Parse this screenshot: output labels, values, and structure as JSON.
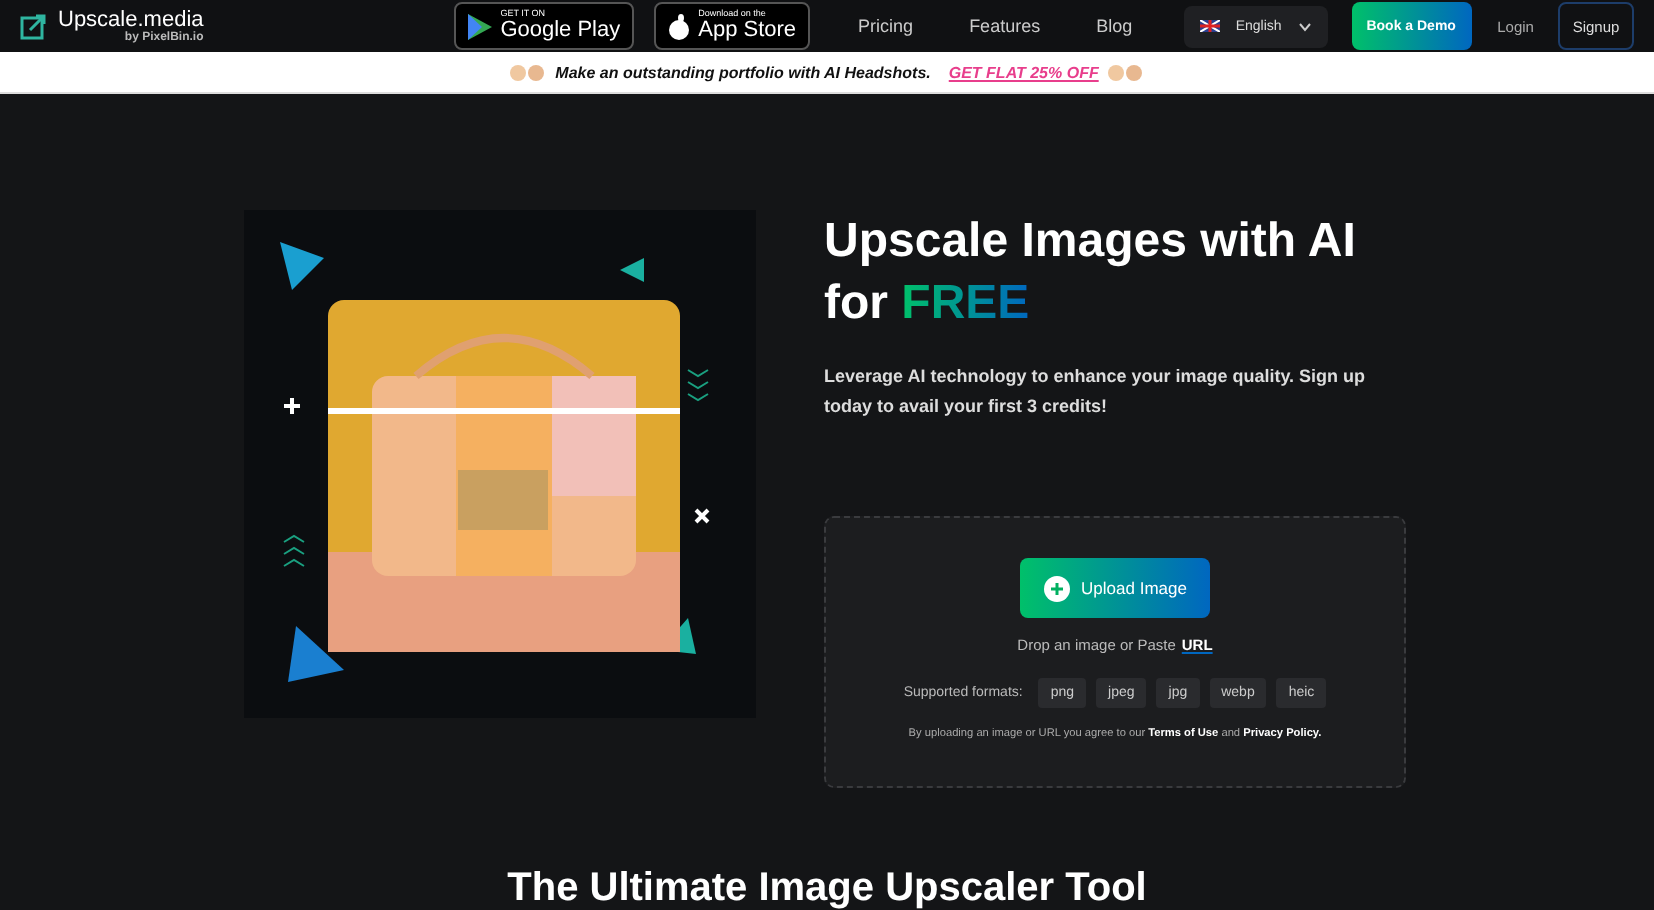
{
  "header": {
    "logo": {
      "name": "Upscale.media",
      "byline": "by PixelBin.io"
    },
    "stores": [
      {
        "kind": "google",
        "small": "GET IT ON",
        "big": "Google Play"
      },
      {
        "kind": "apple",
        "small": "Download on the",
        "big": "App Store"
      }
    ],
    "nav": [
      "Pricing",
      "Features",
      "Blog"
    ],
    "language": "English",
    "demo": "Book a Demo",
    "login": "Login",
    "signup": "Signup"
  },
  "promo": {
    "text": "Make an outstanding portfolio with AI Headshots.",
    "link": "GET FLAT 25% OFF"
  },
  "hero": {
    "title": "Upscale Images with AI for",
    "highlight": "FREE",
    "subtitle": "Leverage AI technology to enhance your image quality. Sign up today to avail your first 3 credits!"
  },
  "upload": {
    "button": "Upload Image",
    "drop_text": "Drop an image or Paste",
    "url_link": "URL",
    "formats_label": "Supported formats:",
    "formats": [
      "png",
      "jpeg",
      "jpg",
      "webp",
      "heic"
    ],
    "legal": "By uploading an image or URL you agree to our **Terms of Use** and **Privacy Policy.**"
  },
  "section_title": "The Ultimate Image Upscaler Tool"
}
